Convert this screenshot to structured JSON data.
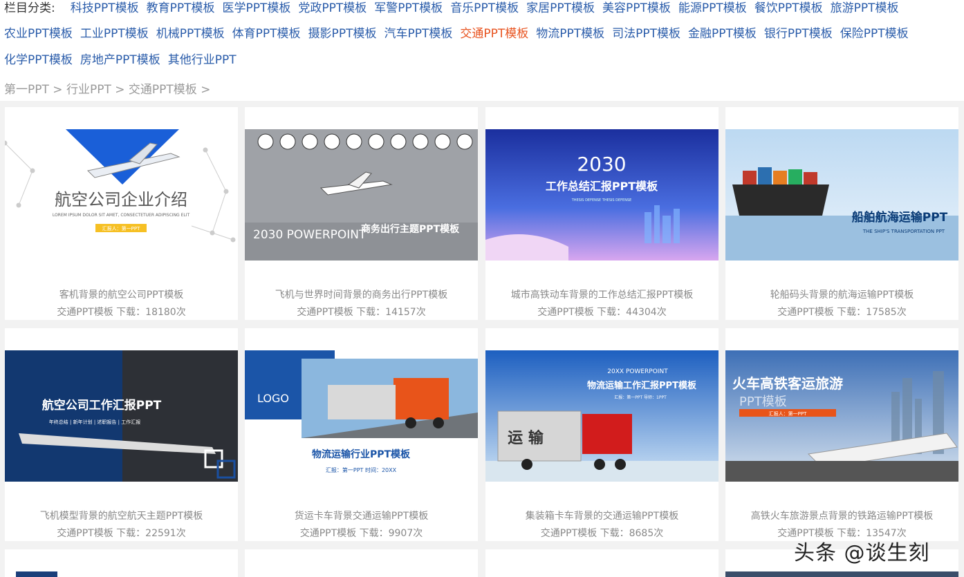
{
  "nav": {
    "label": "栏目分类:",
    "rows": [
      [
        "科技PPT模板",
        "教育PPT模板",
        "医学PPT模板",
        "党政PPT模板",
        "军警PPT模板",
        "音乐PPT模板",
        "家居PPT模板",
        "美容PPT模板",
        "能源PPT模板",
        "餐饮PPT模板",
        "旅游PPT模板"
      ],
      [
        "农业PPT模板",
        "工业PPT模板",
        "机械PPT模板",
        "体育PPT模板",
        "摄影PPT模板",
        "汽车PPT模板",
        "交通PPT模板",
        "物流PPT模板",
        "司法PPT模板",
        "金融PPT模板",
        "银行PPT模板",
        "保险PPT模板"
      ],
      [
        "化学PPT模板",
        "房地产PPT模板",
        "其他行业PPT"
      ]
    ],
    "active": "交通PPT模板"
  },
  "breadcrumb": [
    "第一PPT",
    "行业PPT",
    "交通PPT模板"
  ],
  "breadcrumb_sep": ">",
  "cards": [
    {
      "title": "客机背景的航空公司PPT模板",
      "meta": "交通PPT模板  下载：18180次",
      "thumb_text": "航空公司企业介绍",
      "thumb_sub": "LOREM IPSUM DOLOR SIT AMET, CONSECTETUER ADIPISCING ELIT",
      "thumb_tag": "汇报人：第一PPT"
    },
    {
      "title": "飞机与世界时间背景的商务出行PPT模板",
      "meta": "交通PPT模板  下载：14157次",
      "thumb_text": "商务出行主题PPT模板",
      "thumb_sub": "2030 POWERPOINT"
    },
    {
      "title": "城市高铁动车背景的工作总结汇报PPT模板",
      "meta": "交通PPT模板  下载：44304次",
      "thumb_text": "工作总结汇报PPT模板",
      "thumb_sub": "2030",
      "thumb_tag": "THESIS DEFENSE THESIS DEFENSE"
    },
    {
      "title": "轮船码头背景的航海运输PPT模板",
      "meta": "交通PPT模板  下载：17585次",
      "thumb_text": "船舶航海运输PPT",
      "thumb_sub": "THE SHIP'S TRANSPORTATION PPT"
    },
    {
      "title": "飞机模型背景的航空航天主题PPT模板",
      "meta": "交通PPT模板  下载：22591次",
      "thumb_text": "航空公司工作汇报PPT",
      "thumb_sub": "年终总结 | 新年计划 | 述职报告 | 工作汇报"
    },
    {
      "title": "货运卡车背景交通运输PPT模板",
      "meta": "交通PPT模板  下载：9907次",
      "thumb_text": "物流运输行业PPT模板",
      "thumb_sub": "汇报：第一PPT  时间：20XX",
      "thumb_tag": "LOGO"
    },
    {
      "title": "集装箱卡车背景的交通运输PPT模板",
      "meta": "交通PPT模板  下载：8685次",
      "thumb_text": "物流运输工作汇报PPT模板",
      "thumb_sub": "20XX POWERPOINT",
      "thumb_tag": "汇报：第一PPT    导师：1PPT",
      "thumb_big": "运 输"
    },
    {
      "title": "高铁火车旅游景点背景的铁路运输PPT模板",
      "meta": "交通PPT模板  下载：13547次",
      "thumb_text": "火车高铁客运旅游",
      "thumb_sub": "PPT模板",
      "thumb_tag": "汇报人：第一PPT"
    }
  ],
  "watermark": "头条 @谈生刻",
  "colors": {
    "link": "#2a5caa",
    "active": "#e8531f",
    "caption": "#888888",
    "bg": "#f2f2f2"
  }
}
